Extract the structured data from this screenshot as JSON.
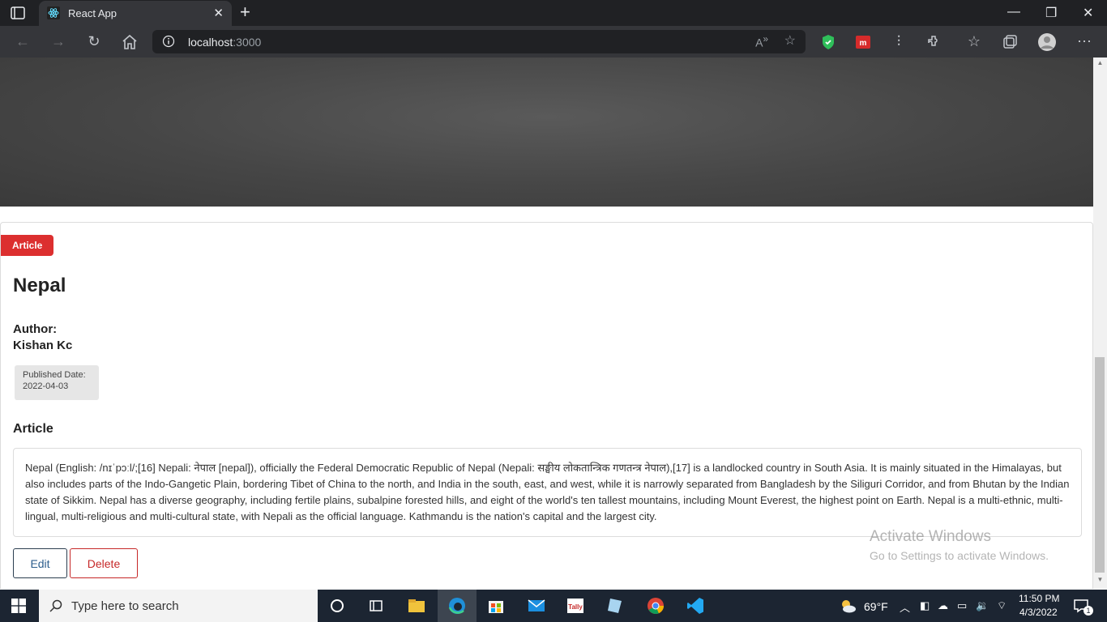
{
  "browser": {
    "tab_title": "React App",
    "tab_close": "✕",
    "new_tab": "+",
    "url_host": "localhost",
    "url_port": ":3000",
    "window_controls": {
      "minimize": "—",
      "restore": "❐",
      "close": "✕"
    }
  },
  "article": {
    "badge": "Article",
    "title": "Nepal",
    "author_label": "Author:",
    "author_name": "Kishan Kc",
    "published_label": "Published Date:",
    "published_date": "2022-04-03",
    "section_heading": "Article",
    "body": "Nepal (English: /nɪˈpɔːl/;[16] Nepali: नेपाल [nepal]), officially the Federal Democratic Republic of Nepal (Nepali: सङ्घीय लोकतान्त्रिक गणतन्त्र नेपाल),[17] is a landlocked country in South Asia. It is mainly situated in the Himalayas, but also includes parts of the Indo-Gangetic Plain, bordering Tibet of China to the north, and India in the south, east, and west, while it is narrowly separated from Bangladesh by the Siliguri Corridor, and from Bhutan by the Indian state of Sikkim. Nepal has a diverse geography, including fertile plains, subalpine forested hills, and eight of the world's ten tallest mountains, including Mount Everest, the highest point on Earth. Nepal is a multi-ethnic, multi-lingual, multi-religious and multi-cultural state, with Nepali as the official language. Kathmandu is the nation's capital and the largest city.",
    "edit_label": "Edit",
    "delete_label": "Delete"
  },
  "watermark": {
    "title": "Activate Windows",
    "subtitle": "Go to Settings to activate Windows."
  },
  "taskbar": {
    "search_placeholder": "Type here to search",
    "weather": "69°F",
    "time": "11:50 PM",
    "date": "4/3/2022",
    "notification_count": "1"
  },
  "colors": {
    "badge": "#dc2f2f",
    "delete": "#c62828",
    "edit_border": "#2c3e50"
  }
}
